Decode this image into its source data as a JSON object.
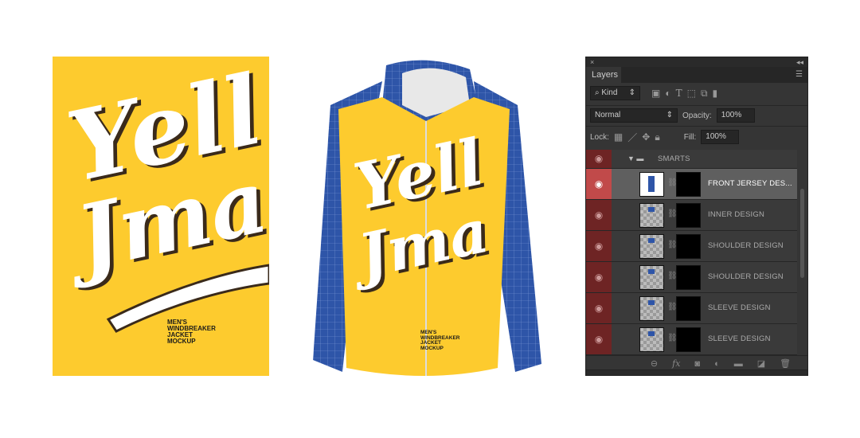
{
  "poster": {
    "script_line1": "Yell",
    "script_line2": "Jma",
    "mockup_text": [
      "MEN'S",
      "WINDBREAKER",
      "JACKET",
      "MOCKUP"
    ],
    "background": "#FDCB2E"
  },
  "jacket": {
    "script_line1": "Yell",
    "script_line2": "Jma",
    "mockup_text": [
      "MEN'S",
      "WINDBREAKER",
      "JACKET",
      "MOCKUP"
    ],
    "body_color": "#FDCB2E",
    "sleeve_color": "#2E55A8"
  },
  "panel": {
    "close_icon": "×",
    "collapse_icon": "◂◂",
    "tab": "Layers",
    "filter_kind": "Kind",
    "blend_mode": "Normal",
    "opacity_label": "Opacity:",
    "opacity_value": "100%",
    "lock_label": "Lock:",
    "fill_label": "Fill:",
    "fill_value": "100%",
    "group": "SMARTS",
    "layers": [
      {
        "name": "FRONT JERSEY DES...",
        "selected": true
      },
      {
        "name": "INNER DESIGN"
      },
      {
        "name": "SHOULDER DESIGN"
      },
      {
        "name": "SHOULDER DESIGN"
      },
      {
        "name": "SLEEVE DESIGN"
      },
      {
        "name": "SLEEVE DESIGN"
      }
    ],
    "footer_fx": "fx"
  }
}
